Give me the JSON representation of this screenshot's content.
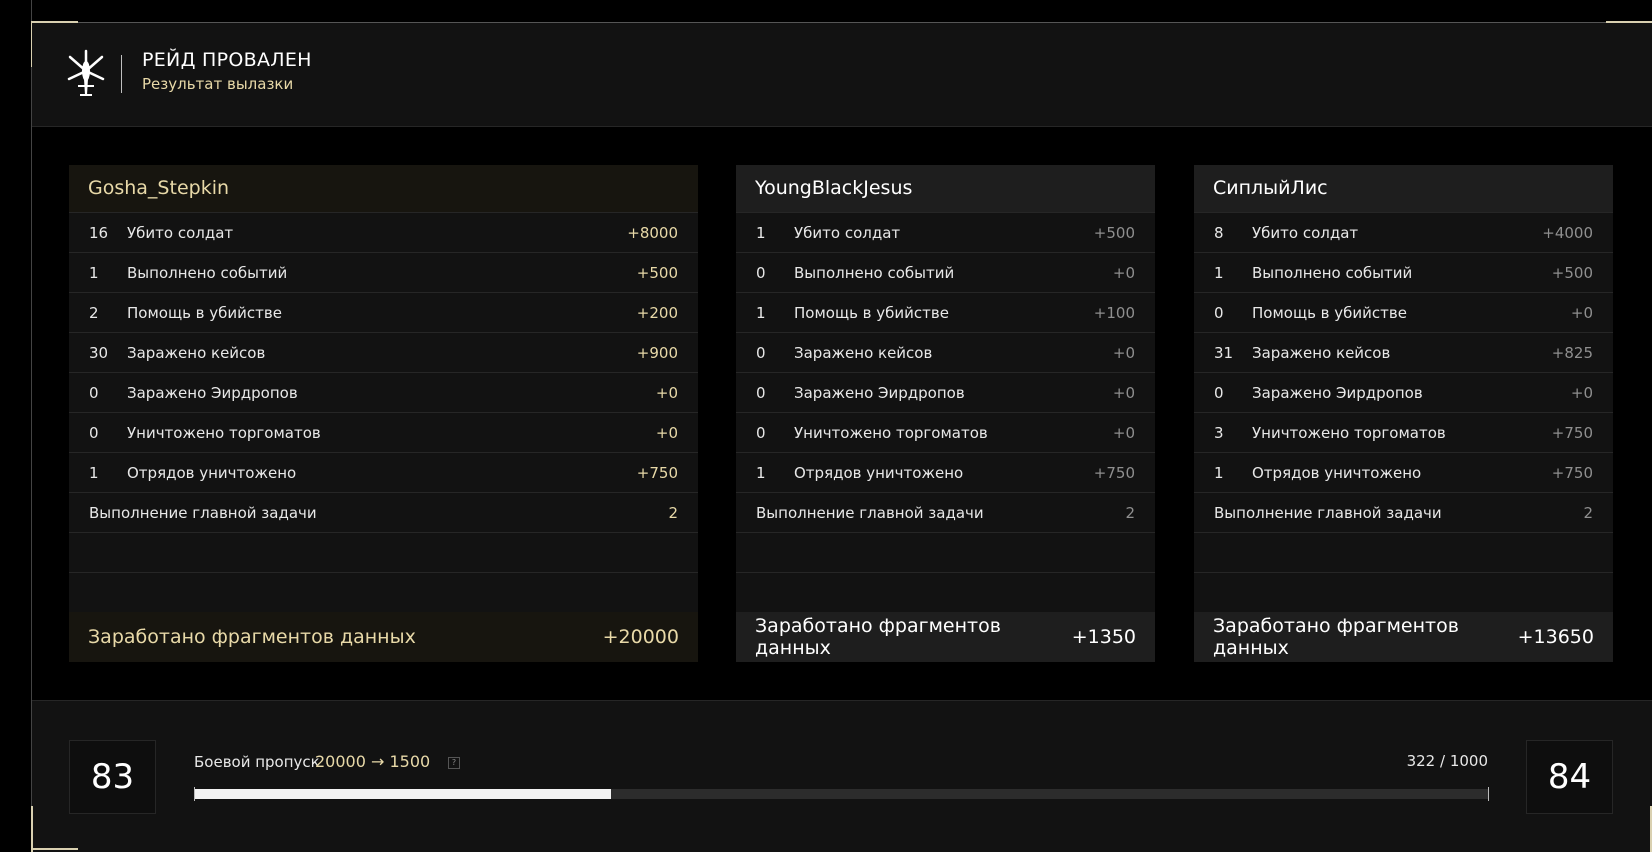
{
  "header": {
    "title": "РЕЙД ПРОВАЛЕН",
    "subtitle": "Результат вылазки",
    "logo_icon": "helicopter-icon"
  },
  "players": [
    {
      "name": "Gosha_Stepkin",
      "highlight": true,
      "stats": [
        {
          "count": "16",
          "label": "Убито солдат",
          "value": "+8000"
        },
        {
          "count": "1",
          "label": "Выполнено событий",
          "value": "+500"
        },
        {
          "count": "2",
          "label": "Помощь в убийстве",
          "value": "+200"
        },
        {
          "count": "30",
          "label": "Заражено кейсов",
          "value": "+900"
        },
        {
          "count": "0",
          "label": "Заражено Эирдропов",
          "value": "+0"
        },
        {
          "count": "0",
          "label": "Уничтожено торгоматов",
          "value": "+0"
        },
        {
          "count": "1",
          "label": "Отрядов уничтожено",
          "value": "+750"
        }
      ],
      "main_task": {
        "label": "Выполнение главной задачи",
        "value": "2"
      },
      "total": {
        "label": "Заработано фрагментов данных",
        "value": "+20000"
      }
    },
    {
      "name": "YoungBlackJesus",
      "highlight": false,
      "stats": [
        {
          "count": "1",
          "label": "Убито солдат",
          "value": "+500"
        },
        {
          "count": "0",
          "label": "Выполнено событий",
          "value": "+0"
        },
        {
          "count": "1",
          "label": "Помощь в убийстве",
          "value": "+100"
        },
        {
          "count": "0",
          "label": "Заражено кейсов",
          "value": "+0"
        },
        {
          "count": "0",
          "label": "Заражено Эирдропов",
          "value": "+0"
        },
        {
          "count": "0",
          "label": "Уничтожено торгоматов",
          "value": "+0"
        },
        {
          "count": "1",
          "label": "Отрядов уничтожено",
          "value": "+750"
        }
      ],
      "main_task": {
        "label": "Выполнение главной задачи",
        "value": "2"
      },
      "total": {
        "label": "Заработано фрагментов данных",
        "value": "+1350"
      }
    },
    {
      "name": "СиплыйЛис",
      "highlight": false,
      "stats": [
        {
          "count": "8",
          "label": "Убито солдат",
          "value": "+4000"
        },
        {
          "count": "1",
          "label": "Выполнено событий",
          "value": "+500"
        },
        {
          "count": "0",
          "label": "Помощь в убийстве",
          "value": "+0"
        },
        {
          "count": "31",
          "label": "Заражено кейсов",
          "value": "+825"
        },
        {
          "count": "0",
          "label": "Заражено Эирдропов",
          "value": "+0"
        },
        {
          "count": "3",
          "label": "Уничтожено торгоматов",
          "value": "+750"
        },
        {
          "count": "1",
          "label": "Отрядов уничтожено",
          "value": "+750"
        }
      ],
      "main_task": {
        "label": "Выполнение главной задачи",
        "value": "2"
      },
      "total": {
        "label": "Заработано фрагментов данных",
        "value": "+13650"
      }
    }
  ],
  "battle_pass": {
    "current_level": "83",
    "next_level": "84",
    "label": "Боевой пропуск",
    "gain": "20000 → 1500",
    "help_icon": "question-icon",
    "progress_text": "322 / 1000",
    "progress_fraction": 0.322
  },
  "colors": {
    "accent_gold": "#e8d9a8",
    "panel_bg": "#121212",
    "muted_value": "#8f8f8f"
  }
}
